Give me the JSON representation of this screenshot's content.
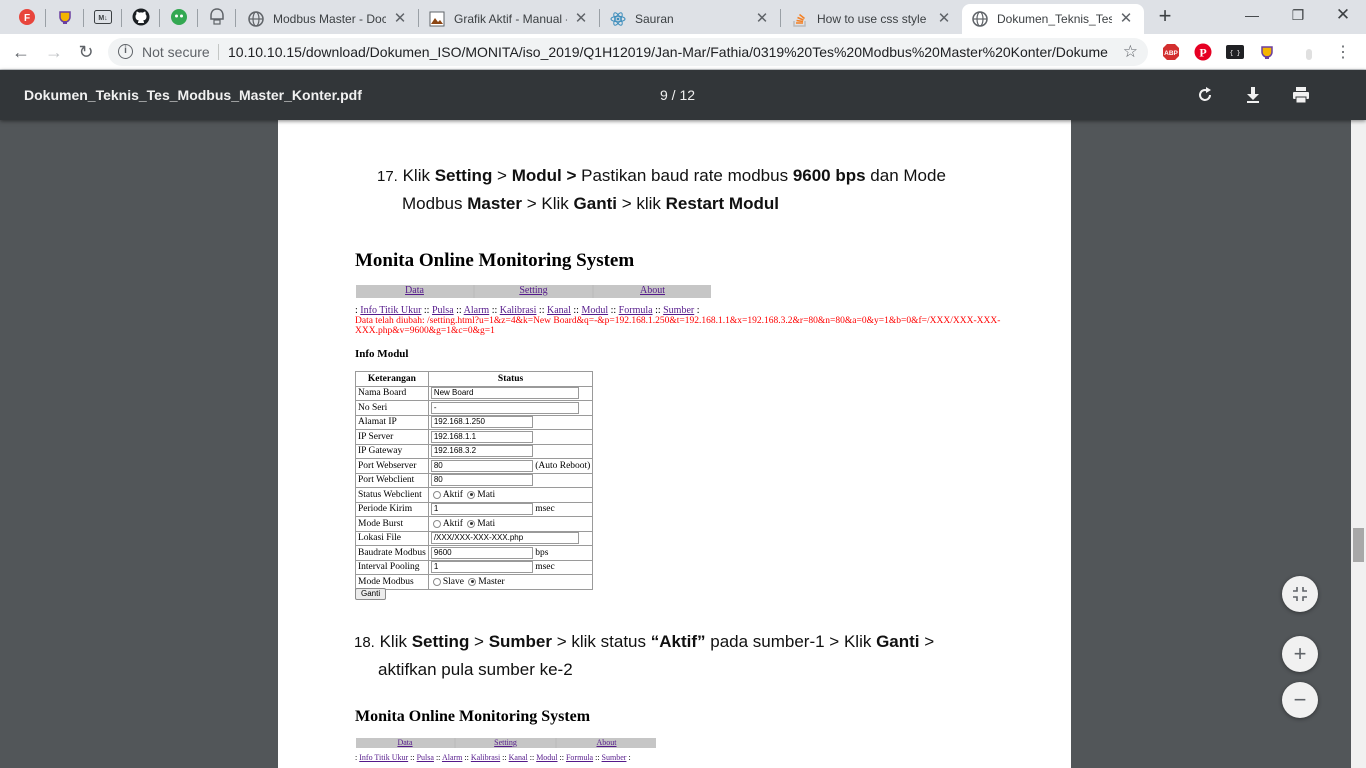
{
  "tabs": [
    {
      "title": "Modbus Master - Doc",
      "icon": "globe-icon",
      "active": false
    },
    {
      "title": "Grafik Aktif - Manual -",
      "icon": "image-icon",
      "active": false
    },
    {
      "title": "Sauran",
      "icon": "react-icon",
      "active": false
    },
    {
      "title": "How to use css style in",
      "icon": "stackoverflow-icon",
      "active": false
    },
    {
      "title": "Dokumen_Teknis_Tes_",
      "icon": "globe-icon",
      "active": true
    }
  ],
  "toolbar": {
    "security": "Not secure",
    "url": "10.10.10.15/download/Dokumen_ISO/MONITA/iso_2019/Q1H12019/Jan-Mar/Fathia/0319%20Tes%20Modbus%20Master%20Konter/Dokume..."
  },
  "pdf": {
    "filename": "Dokumen_Teknis_Tes_Modbus_Master_Konter.pdf",
    "page_count": "9 / 12"
  },
  "doc": {
    "step17": {
      "num": "17.",
      "line1": [
        "Klik ",
        "Setting",
        " > ",
        "Modul",
        " > ",
        "Pastikan baud rate modbus ",
        "9600 bps",
        " dan Mode"
      ],
      "line2": [
        "Modbus ",
        "Master",
        " > Klik ",
        "Ganti",
        " > klik ",
        "Restart Modul"
      ]
    },
    "monita1": {
      "title": "Monita Online Monitoring System",
      "menu": [
        "Data",
        "Setting",
        "About"
      ],
      "sublinks": [
        "Info Titik Ukur",
        "Pulsa",
        "Alarm",
        "Kalibrasi",
        "Kanal",
        "Modul",
        "Formula",
        "Sumber"
      ],
      "changed_line1": "Data telah diubah: /setting.html?u=1&z=4&k=New Board&q=-&p=192.168.1.250&t=192.168.1.1&x=192.168.3.2&r=80&n=80&a=0&y=1&b=0&f=/XXX/XXX-XXX-",
      "changed_line2": "XXX.php&v=9600&g=1&c=0&g=1",
      "info_heading": "Info Modul",
      "table_headers": [
        "Keterangan",
        "Status"
      ],
      "rows": {
        "nama_board": {
          "label": "Nama Board",
          "value": "New Board"
        },
        "no_seri": {
          "label": "No Seri",
          "value": "-"
        },
        "alamat_ip": {
          "label": "Alamat IP",
          "value": "192.168.1.250"
        },
        "ip_server": {
          "label": "IP Server",
          "value": "192.168.1.1"
        },
        "ip_gateway": {
          "label": "IP Gateway",
          "value": "192.168.3.2"
        },
        "port_webserver": {
          "label": "Port Webserver",
          "value": "80",
          "suffix": "(Auto Reboot)"
        },
        "port_webclient": {
          "label": "Port Webclient",
          "value": "80"
        },
        "status_webclient": {
          "label": "Status Webclient",
          "opt1": "Aktif",
          "opt2": "Mati"
        },
        "periode_kirim": {
          "label": "Periode Kirim",
          "value": "1",
          "suffix": "msec"
        },
        "mode_burst": {
          "label": "Mode Burst",
          "opt1": "Aktif",
          "opt2": "Mati"
        },
        "lokasi_file": {
          "label": "Lokasi File",
          "value": "/XXX/XXX-XXX-XXX.php"
        },
        "baudrate": {
          "label": "Baudrate Modbus",
          "value": "9600",
          "suffix": "bps"
        },
        "interval": {
          "label": "Interval Pooling",
          "value": "1",
          "suffix": "msec"
        },
        "mode_modbus": {
          "label": "Mode Modbus",
          "opt1": "Slave",
          "opt2": "Master"
        }
      },
      "button": "Ganti"
    },
    "step18": {
      "num": "18.",
      "line1": [
        "Klik ",
        "Setting",
        " > ",
        "Sumber",
        " > klik status ",
        "“Aktif”",
        " pada sumber-1 > Klik ",
        "Ganti",
        " >"
      ],
      "line2": "aktifkan pula sumber ke-2"
    },
    "monita2": {
      "title": "Monita Online Monitoring System",
      "menu": [
        "Data",
        "Setting",
        "About"
      ],
      "sublinks": [
        "Info Titik Ukur",
        "Pulsa",
        "Alarm",
        "Kalibrasi",
        "Kanal",
        "Modul",
        "Formula",
        "Sumber"
      ]
    }
  }
}
